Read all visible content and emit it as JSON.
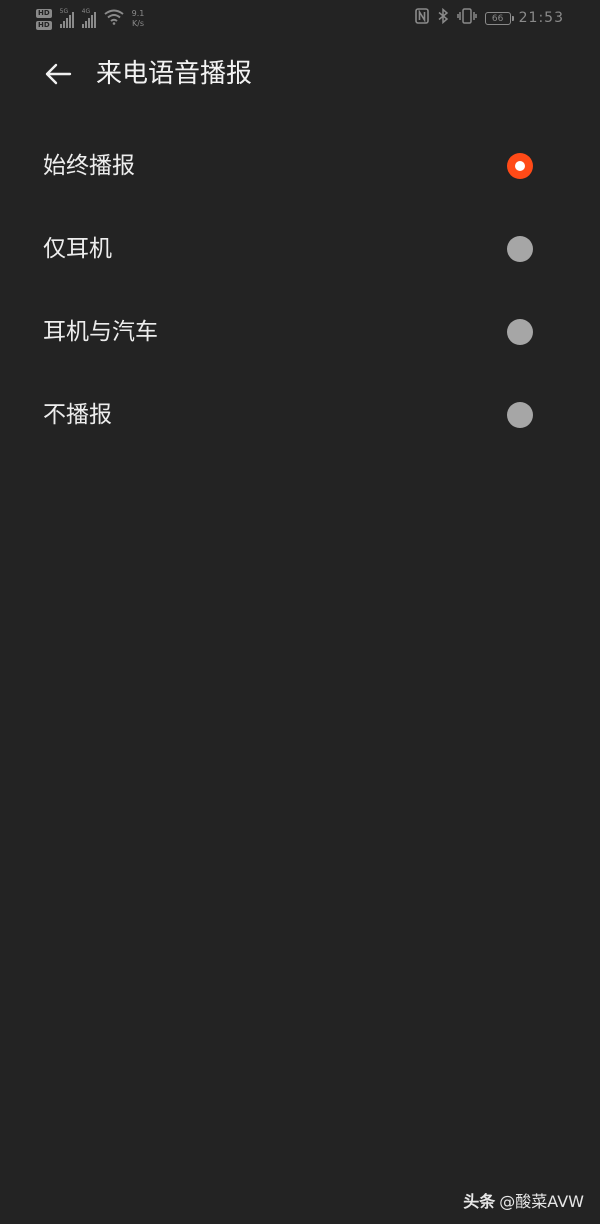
{
  "status_bar": {
    "hd_badges": [
      "HD",
      "HD"
    ],
    "network_gen": [
      "5G",
      "4G"
    ],
    "net_speed_value": "9.1",
    "net_speed_unit": "K/s",
    "battery": "66",
    "time": "21:53",
    "icons": [
      "nfc-icon",
      "bluetooth-icon",
      "vibrate-icon",
      "wifi-icon",
      "signal-icon"
    ]
  },
  "header": {
    "title": "来电语音播报",
    "back_icon": "back-arrow-icon"
  },
  "options": [
    {
      "label": "始终播报",
      "selected": true
    },
    {
      "label": "仅耳机",
      "selected": false
    },
    {
      "label": "耳机与汽车",
      "selected": false
    },
    {
      "label": "不播报",
      "selected": false
    }
  ],
  "colors": {
    "background": "#232323",
    "accent": "#ff4a17",
    "radio_off": "#a6a6a6",
    "text": "#ededed"
  },
  "watermark": {
    "brand": "头条",
    "handle": "@酸菜AVW"
  }
}
